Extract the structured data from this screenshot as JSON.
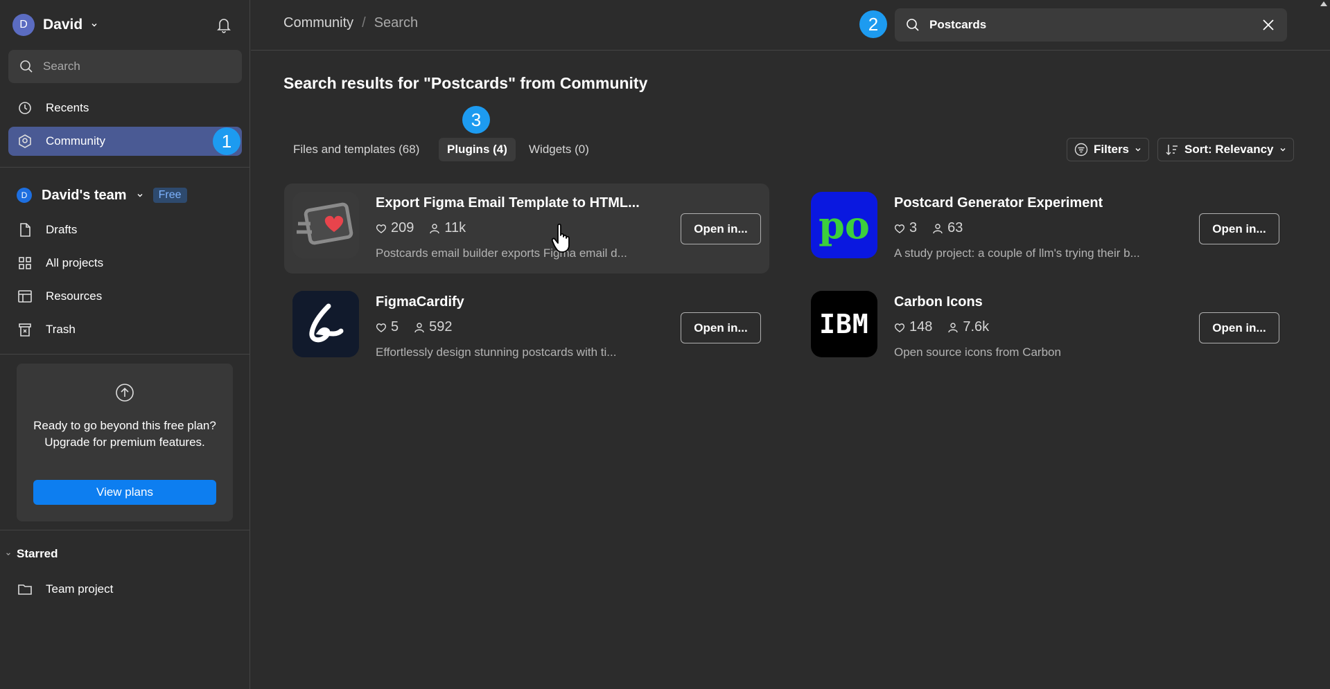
{
  "sidebar": {
    "user": {
      "initial": "D",
      "name": "David"
    },
    "search_placeholder": "Search",
    "nav": [
      {
        "label": "Recents",
        "icon": "clock-icon"
      },
      {
        "label": "Community",
        "icon": "community-icon",
        "active": true,
        "badge": "1"
      }
    ],
    "team": {
      "initial": "D",
      "name": "David's team",
      "plan": "Free"
    },
    "team_nav": [
      {
        "label": "Drafts",
        "icon": "file-icon"
      },
      {
        "label": "All projects",
        "icon": "grid-icon"
      },
      {
        "label": "Resources",
        "icon": "resources-icon"
      },
      {
        "label": "Trash",
        "icon": "trash-icon"
      }
    ],
    "upgrade": {
      "text": "Ready to go beyond this free plan? Upgrade for premium features.",
      "button": "View plans"
    },
    "starred": {
      "label": "Starred",
      "items": [
        {
          "label": "Team project",
          "icon": "folder-icon"
        }
      ]
    }
  },
  "header": {
    "breadcrumb": [
      "Community",
      "Search"
    ],
    "search_value": "Postcards",
    "marker_2": "2"
  },
  "main": {
    "title": "Search results for \"Postcards\" from Community",
    "marker_3": "3",
    "tabs": [
      {
        "label": "Files and templates (68)"
      },
      {
        "label": "Plugins (4)",
        "active": true
      },
      {
        "label": "Widgets (0)"
      }
    ],
    "filters_label": "Filters",
    "sort_label": "Sort: Relevancy",
    "results": [
      {
        "title": "Export Figma Email Template to HTML...",
        "likes": "209",
        "users": "11k",
        "desc": "Postcards email builder exports Figma email d...",
        "button": "Open in..."
      },
      {
        "title": "Postcard Generator Experiment",
        "likes": "3",
        "users": "63",
        "desc": "A study project: a couple of llm's trying their b...",
        "button": "Open in...",
        "thumb_text": "po"
      },
      {
        "title": "FigmaCardify",
        "likes": "5",
        "users": "592",
        "desc": "Effortlessly design stunning postcards with ti...",
        "button": "Open in..."
      },
      {
        "title": "Carbon Icons",
        "likes": "148",
        "users": "7.6k",
        "desc": "Open source icons from Carbon",
        "button": "Open in...",
        "thumb_text": "IBM"
      }
    ]
  },
  "colors": {
    "accent": "#0d7ef0",
    "marker": "#1d9bf0",
    "active_nav": "#4a5a94",
    "background": "#2c2c2c"
  }
}
